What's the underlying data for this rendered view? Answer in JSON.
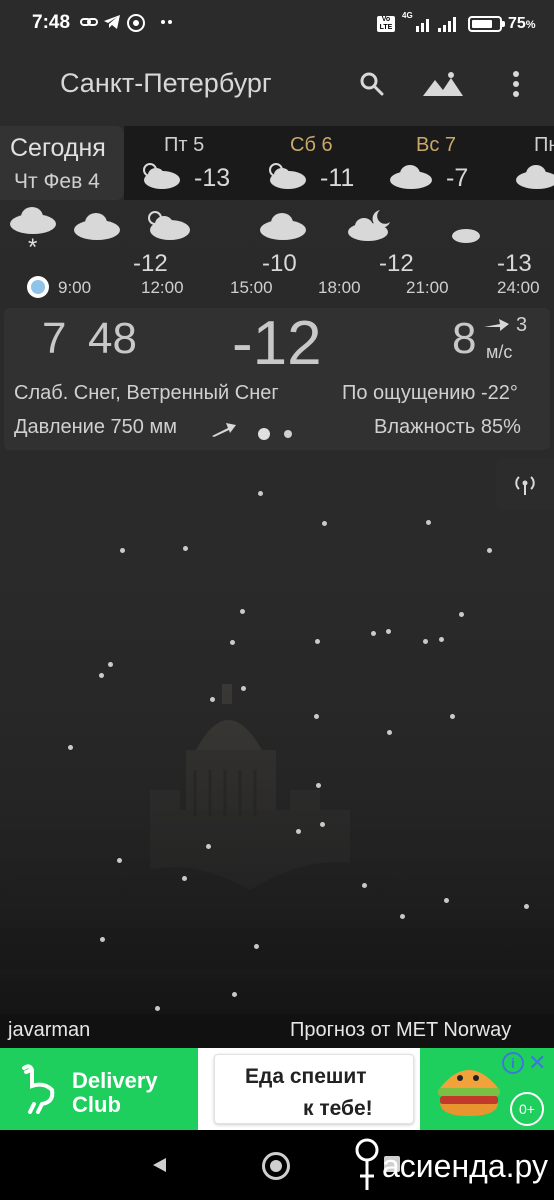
{
  "status_bar": {
    "time": "7:48",
    "icons": [
      "link-icon",
      "telegram-icon",
      "chrome-icon",
      "more-dots-icon"
    ],
    "volte": "Vo LTE",
    "network": "4G",
    "battery_percent": "75",
    "battery_level": 0.75,
    "percent_sign": "%"
  },
  "app_bar": {
    "city": "Санкт-Петербург",
    "icons": [
      "search-icon",
      "landscape-icon",
      "overflow-menu-icon"
    ]
  },
  "daily": {
    "today_label": "Сегодня",
    "today_date": "Чт Фев 4",
    "days": [
      {
        "label": "Пт 5",
        "temp": "-13",
        "color": "#cfcfcf",
        "icon": "partly-sunny-cloud-icon"
      },
      {
        "label": "Сб 6",
        "temp": "-11",
        "color": "#c9a86a",
        "icon": "partly-sunny-cloud-icon"
      },
      {
        "label": "Вс 7",
        "temp": "-7",
        "color": "#c9a86a",
        "icon": "cloud-icon"
      },
      {
        "label": "Пн",
        "temp": "",
        "color": "#cfcfcf",
        "icon": "cloud-icon"
      }
    ]
  },
  "hourly": {
    "times": [
      "9:00",
      "12:00",
      "15:00",
      "18:00",
      "21:00",
      "24:00"
    ],
    "temps": [
      "",
      "-12",
      "-10",
      "-12",
      "-13"
    ],
    "icons": [
      "snow-cloud-icon",
      "cloud-icon",
      "partly-sunny-cloud-icon",
      "cloud-icon",
      "moon-cloud-icon",
      "moon-cloud-icon"
    ]
  },
  "current": {
    "time_hour": "7",
    "time_min": "48",
    "temp": "-12",
    "wind_speed": "8",
    "wind_gust": "3",
    "wind_unit": "м/с",
    "condition": "Слаб. Снег, Ветренный Снег",
    "feels_like": "По ощущению -22°",
    "pressure": "Давление 750 мм",
    "humidity": "Влажность 85%"
  },
  "footer": {
    "author": "javarman",
    "provider": "Прогноз от MET Norway"
  },
  "ad": {
    "brand_line1": "Delivery",
    "brand_line2": "Club",
    "headline_line1": "Еда спешит",
    "headline_line2": "к тебе!",
    "age": "0+",
    "info_glyph": "i",
    "close_glyph": "✕"
  },
  "watermark": "асиенда.ру",
  "colors": {
    "accent_day_weekend": "#c9a86a",
    "ad_green": "#1fcf5e",
    "current_dot": "#8fc3e8"
  }
}
